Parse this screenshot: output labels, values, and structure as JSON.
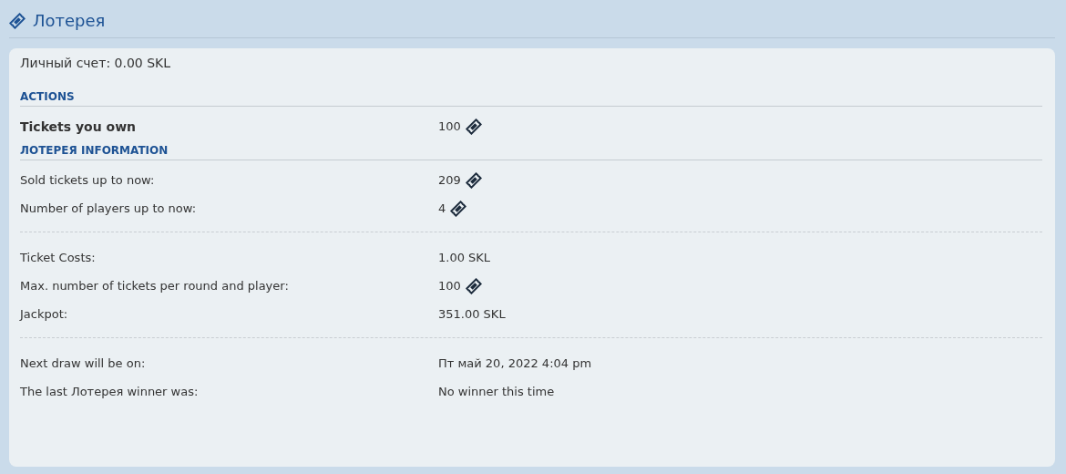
{
  "title": "Лотерея",
  "account": "Личный счет: 0.00 SKL",
  "sections": [
    {
      "heading": "ACTIONS",
      "groups": [
        [
          {
            "label": "Tickets you own",
            "value": "100",
            "ticket": true,
            "bold": true
          }
        ]
      ]
    },
    {
      "heading": "ЛОТЕРЕЯ INFORMATION",
      "groups": [
        [
          {
            "label": "Sold tickets up to now:",
            "value": "209",
            "ticket": true,
            "bold": false
          },
          {
            "label": "Number of players up to now:",
            "value": "4",
            "ticket": true,
            "bold": false
          }
        ],
        [
          {
            "label": "Ticket Costs:",
            "value": "1.00 SKL",
            "ticket": false,
            "bold": false
          },
          {
            "label": "Max. number of tickets per round and player:",
            "value": "100",
            "ticket": true,
            "bold": false
          },
          {
            "label": "Jackpot:",
            "value": "351.00 SKL",
            "ticket": false,
            "bold": false
          }
        ],
        [
          {
            "label": "Next draw will be on:",
            "value": "Пт май 20, 2022 4:04 pm",
            "ticket": false,
            "bold": false
          },
          {
            "label": "The last Лотерея winner was:",
            "value": "No winner this time",
            "ticket": false,
            "bold": false
          }
        ]
      ]
    }
  ]
}
